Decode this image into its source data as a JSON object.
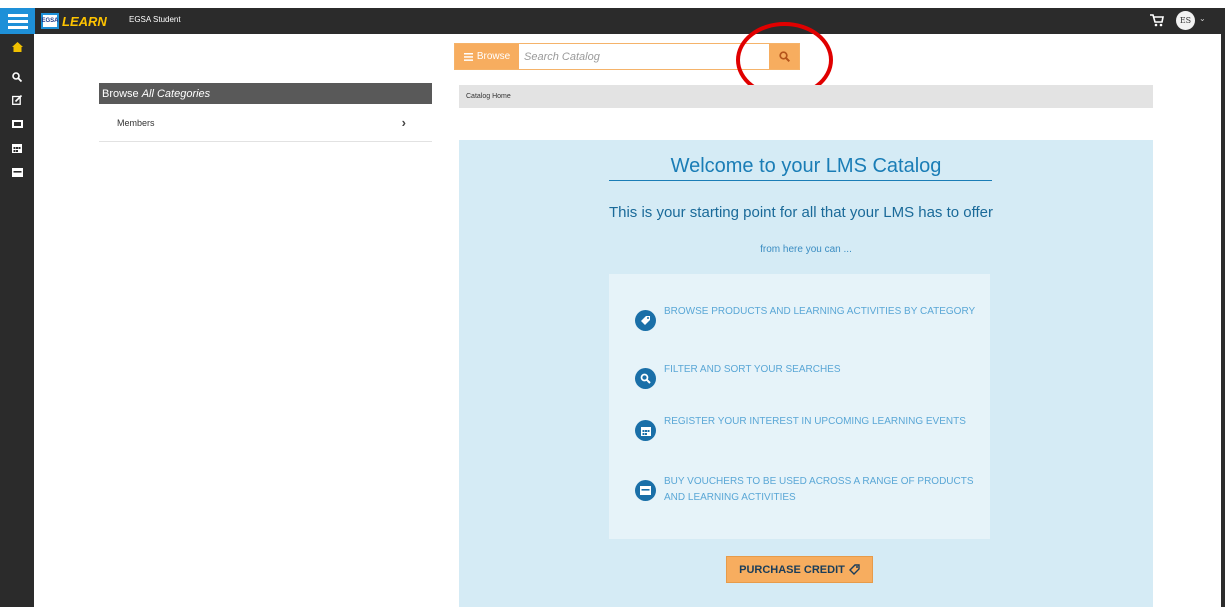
{
  "topbar": {
    "logo_badge": "EGSA",
    "logo_text": "LEARN",
    "user_name": "EGSA Student",
    "avatar_initials": "ES",
    "avatar_caret": "⌄",
    "cart_icon": "cart-icon"
  },
  "left_rail": {
    "icons": [
      "home-icon",
      "search-icon",
      "edit-icon",
      "ticket-icon",
      "calendar-icon",
      "voucher-icon"
    ]
  },
  "search": {
    "browse_label": "Browse",
    "placeholder": "Search Catalog",
    "button_icon": "search-icon"
  },
  "categories": {
    "header_prefix": "Browse",
    "header_emphasis": "All Categories",
    "items": [
      {
        "label": "Members",
        "chevron": "›"
      }
    ]
  },
  "breadcrumb": {
    "label": "Catalog Home"
  },
  "welcome": {
    "title": "Welcome to your LMS Catalog",
    "subtitle": "This is your starting point for all that your LMS has to offer",
    "small": "from here you can ...",
    "features": [
      {
        "icon": "tag-icon",
        "text": "Browse products and learning activities by category"
      },
      {
        "icon": "search-icon",
        "text": "Filter and sort your searches"
      },
      {
        "icon": "calendar-icon",
        "text": "Register your interest in upcoming learning events"
      },
      {
        "icon": "voucher-icon",
        "text": "Buy vouchers to be used across a range of products and learning activities"
      }
    ],
    "purchase_label": "PURCHASE CREDIT"
  }
}
